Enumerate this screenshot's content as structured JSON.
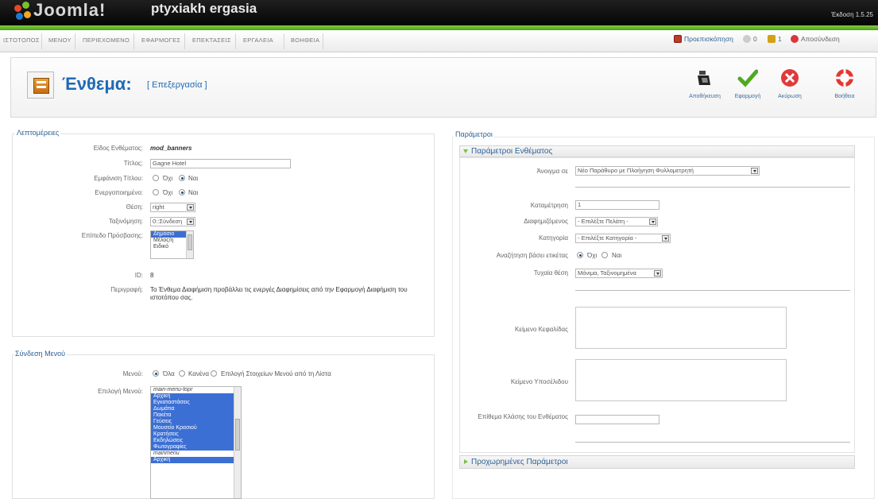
{
  "header": {
    "logo_text": "Joomla!",
    "site_name": "ptyxiakh ergasia",
    "version": "Έκδοση 1.5.25"
  },
  "menu": [
    "ΙΣΤΟΤΟΠΟΣ",
    "ΜΕΝΟΥ",
    "ΠΕΡΙΕΧΟΜΕΝΟ",
    "ΕΦΑΡΜΟΓΕΣ",
    "ΕΠΕΚΤΑΣΕΙΣ",
    "ΕΡΓΑΛΕΙΑ",
    "ΒΟΗΘΕΙΑ"
  ],
  "status": {
    "preview": "Προεπισκόπηση",
    "online_count": "0",
    "messages_count": "1",
    "logout": "Αποσύνδεση"
  },
  "toolbar": {
    "title": "Ένθεμα:",
    "subtitle": "[ Επεξεργασία ]",
    "buttons": [
      "Αποθήκευση",
      "Εφαρμογή",
      "Ακύρωση",
      "Βοήθεια"
    ]
  },
  "details": {
    "legend": "Λεπτομέρειες",
    "module_type_label": "Είδος Ενθέματος:",
    "module_type_value": "mod_banners",
    "title_label": "Τίτλος:",
    "title_value": "Gagne Hotel",
    "show_title_label": "Εμφάνιση Τίτλου:",
    "enabled_label": "Ενεργοποιημένο:",
    "radio_no": "Όχι",
    "radio_yes": "Ναι",
    "position_label": "Θέση:",
    "position_value": "right",
    "order_label": "Ταξινόμηση:",
    "order_value": "0::Σύνδεση",
    "access_label": "Επίπεδο Πρόσβασης:",
    "access_options": [
      "Δημόσιο",
      "Μέλος/η",
      "Ειδικό"
    ],
    "access_selected": 0,
    "id_label": "ID:",
    "id_value": "8",
    "description_label": "Περιγραφή:",
    "description_value": "Το Ένθεμα Διαφήμιση προβάλλει τις ενεργές Διαφημίσεις από την Εφαρμογή Διαφήμιση του ιστοτόπου σας."
  },
  "menu_assignment": {
    "legend": "Σύνδεση Μενού",
    "menus_label": "Μενού:",
    "opt_all": "Όλα",
    "opt_none": "Κανένα",
    "opt_select": "Επιλογή Στοιχείων Μενού από τη Λίστα",
    "selection_label": "Επιλογή Μενού:",
    "list": [
      {
        "text": "main-menu-topr",
        "sel": false
      },
      {
        "text": "Αρχική",
        "sel": true
      },
      {
        "text": "Εγκαταστάσεις",
        "sel": true
      },
      {
        "text": "Δωμάτια",
        "sel": true
      },
      {
        "text": "Πακέτα",
        "sel": true
      },
      {
        "text": "Γεύσεις",
        "sel": true
      },
      {
        "text": "Μουσείο Κρασιού",
        "sel": true
      },
      {
        "text": "Κρατήσεις",
        "sel": true
      },
      {
        "text": "Εκδηλώσεις",
        "sel": true
      },
      {
        "text": "Φωτογραφίες",
        "sel": true
      },
      {
        "text": "mainmenu",
        "sel": false
      },
      {
        "text": "Αρχική",
        "sel": true
      }
    ]
  },
  "params": {
    "legend": "Παράμετροι",
    "section_title": "Παράμετροι Ενθέματος",
    "target_label": "Άνοιγμα σε",
    "target_value": "Νέο Παράθυρο με Πλοήγηση Φυλλομετρητή",
    "count_label": "Καταμέτρηση",
    "count_value": "1",
    "client_label": "Διαφημιζόμενος",
    "client_value": "- Επιλέξτε Πελάτη -",
    "category_label": "Κατηγορία",
    "category_value": "- Επιλέξτε Κατηγορία -",
    "search_label": "Αναζήτηση βάσει ετικέτας",
    "search_no": "Όχι",
    "search_yes": "Ναι",
    "random_label": "Τυχαία θέση",
    "random_value": "Μόνιμα, Ταξινομημένα",
    "header_text_label": "Κείμενο Κεφαλίδας",
    "footer_text_label": "Κείμενο Υποσέλιδου",
    "suffix_label": "Επίθεμα Κλάσης του Ενθέματος",
    "advanced_title": "Προχωρημένες Παράμετροι"
  },
  "colors": {
    "accent_blue": "#1e6ab5",
    "header_green": "#5cad23",
    "selection_blue": "#3c6fd3"
  }
}
